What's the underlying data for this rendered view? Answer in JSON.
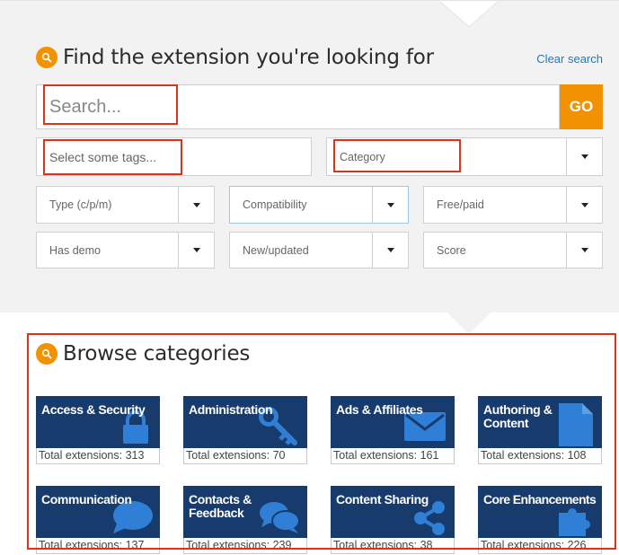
{
  "search": {
    "heading": "Find the extension you're looking for",
    "clear_label": "Clear search",
    "input_placeholder": "Search...",
    "go_label": "GO"
  },
  "filters": {
    "tags_placeholder": "Select some tags...",
    "category": "Category",
    "type": "Type (c/p/m)",
    "compatibility": "Compatibility",
    "free_paid": "Free/paid",
    "has_demo": "Has demo",
    "new_updated": "New/updated",
    "score": "Score"
  },
  "browse": {
    "heading": "Browse categories",
    "categories": [
      {
        "title": "Access & Security",
        "count": "Total extensions: 313",
        "icon": "lock-icon"
      },
      {
        "title": "Administration",
        "count": "Total extensions: 70",
        "icon": "key-icon"
      },
      {
        "title": "Ads & Affiliates",
        "count": "Total extensions: 161",
        "icon": "envelope-icon"
      },
      {
        "title": "Authoring & Content",
        "count": "Total extensions: 108",
        "icon": "document-icon"
      },
      {
        "title": "Communication",
        "count": "Total extensions: 137",
        "icon": "speech-bubble-icon"
      },
      {
        "title": "Contacts & Feedback",
        "count": "Total extensions: 239",
        "icon": "chat-bubbles-icon"
      },
      {
        "title": "Content Sharing",
        "count": "Total extensions: 38",
        "icon": "share-icon"
      },
      {
        "title": "Core Enhancements",
        "count": "Total extensions: 226",
        "icon": "puzzle-icon"
      }
    ]
  },
  "colors": {
    "accent": "#f39200",
    "tile_bg": "#173b6c",
    "tile_icon": "#2f7fd6",
    "link": "#1a7bbf",
    "highlight": "#d8341c"
  }
}
